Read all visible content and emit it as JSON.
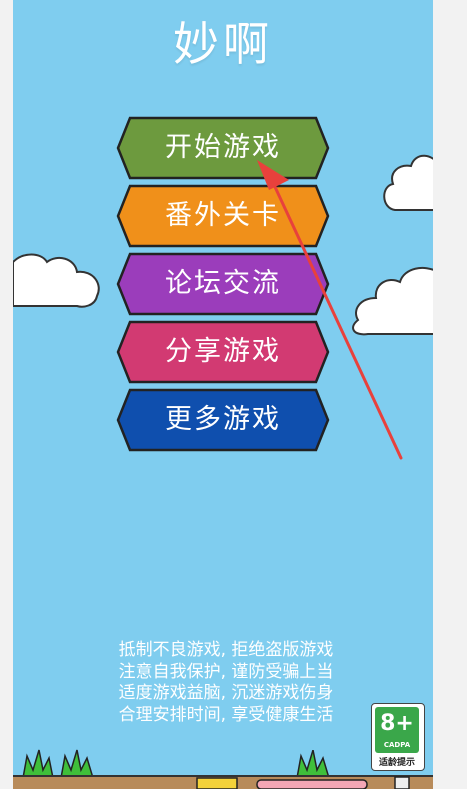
{
  "title": "妙啊",
  "menu": [
    {
      "label": "开始游戏",
      "color": "#6d9a3e"
    },
    {
      "label": "番外关卡",
      "color": "#f0901a"
    },
    {
      "label": "论坛交流",
      "color": "#9b3dbb"
    },
    {
      "label": "分享游戏",
      "color": "#d23a72"
    },
    {
      "label": "更多游戏",
      "color": "#0f4fae"
    }
  ],
  "notice": {
    "line1": "抵制不良游戏, 拒绝盗版游戏",
    "line2": "注意自我保护, 谨防受骗上当",
    "line3": "适度游戏益脑, 沉迷游戏伤身",
    "line4": "合理安排时间, 享受健康生活"
  },
  "age_rating": {
    "rating": "8+",
    "org": "CADPA",
    "tip": "适龄提示",
    "color": "#3aa74a"
  },
  "colors": {
    "sky": "#7fcdef",
    "annotation_arrow": "#e8413c"
  }
}
